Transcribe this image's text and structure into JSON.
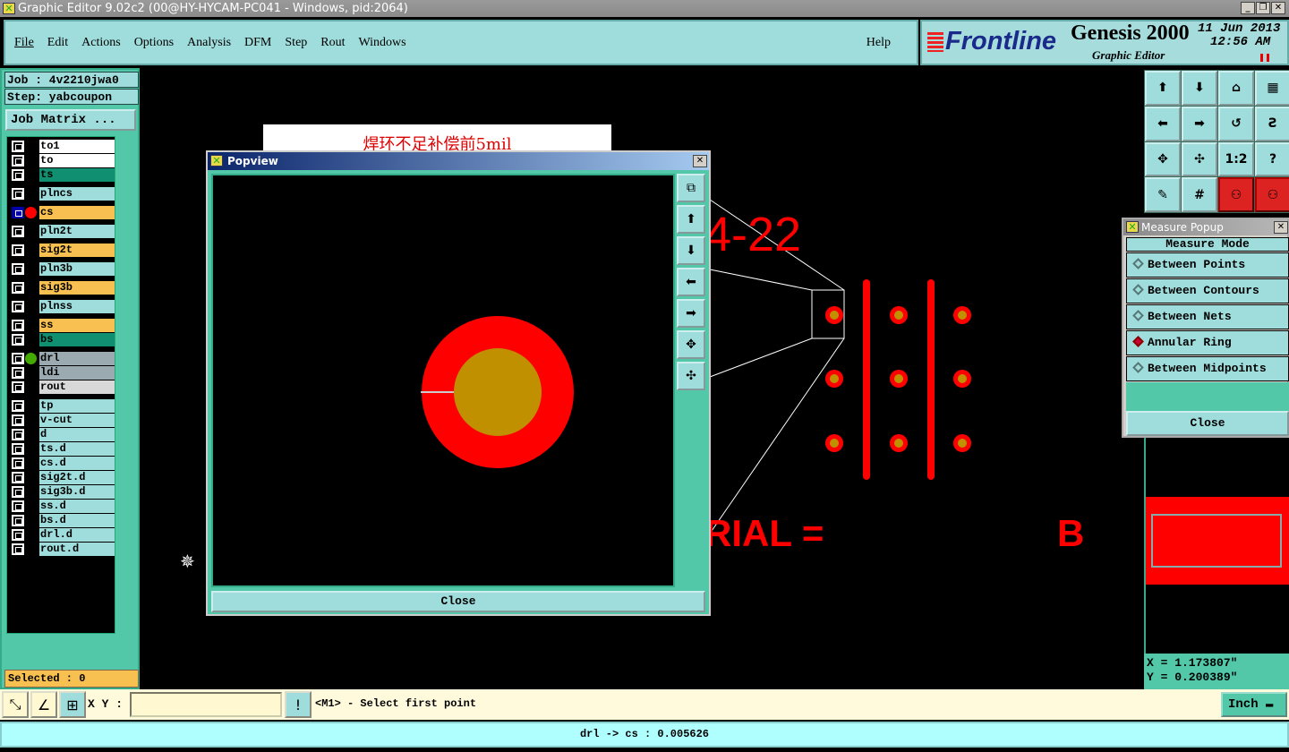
{
  "window": {
    "title": "Graphic Editor 9.02c2 (00@HY-HYCAM-PC041 - Windows, pid:2064)",
    "min": "_",
    "restore": "❐",
    "close": "✕"
  },
  "menu": {
    "items": [
      "File",
      "Edit",
      "Actions",
      "Options",
      "Analysis",
      "DFM",
      "Step",
      "Rout",
      "Windows"
    ],
    "help": "Help"
  },
  "brand": {
    "logo": "Frontline",
    "product": "Genesis 2000",
    "subtitle": "Graphic Editor",
    "date": "11 Jun 2013",
    "time": "12:56 AM"
  },
  "job": {
    "job": "Job : 4v2210jwa0",
    "step": "Step: yabcoupon",
    "matrix": "Job Matrix ..."
  },
  "layers": [
    {
      "name": "to1",
      "color": "#ffffff"
    },
    {
      "name": "to",
      "color": "#ffffff"
    },
    {
      "name": "ts",
      "color": "#109070"
    },
    {
      "name": "plncs",
      "color": "#9fdcdc"
    },
    {
      "name": "cs",
      "color": "#f7c050"
    },
    {
      "name": "pln2t",
      "color": "#9fdcdc"
    },
    {
      "name": "sig2t",
      "color": "#f7c050"
    },
    {
      "name": "pln3b",
      "color": "#9fdcdc"
    },
    {
      "name": "sig3b",
      "color": "#f7c050"
    },
    {
      "name": "plnss",
      "color": "#9fdcdc"
    },
    {
      "name": "ss",
      "color": "#f7c050"
    },
    {
      "name": "bs",
      "color": "#109070"
    },
    {
      "name": "drl",
      "color": "#9aaab0"
    },
    {
      "name": "ldi",
      "color": "#9aaab0"
    },
    {
      "name": "rout",
      "color": "#d8d8d8"
    },
    {
      "name": "tp",
      "color": "#9fdcdc"
    },
    {
      "name": "v-cut",
      "color": "#9fdcdc"
    },
    {
      "name": "d",
      "color": "#9fdcdc"
    },
    {
      "name": "ts.d",
      "color": "#9fdcdc"
    },
    {
      "name": "cs.d",
      "color": "#9fdcdc"
    },
    {
      "name": "sig2t.d",
      "color": "#9fdcdc"
    },
    {
      "name": "sig3b.d",
      "color": "#9fdcdc"
    },
    {
      "name": "ss.d",
      "color": "#9fdcdc"
    },
    {
      "name": "bs.d",
      "color": "#9fdcdc"
    },
    {
      "name": "drl.d",
      "color": "#9fdcdc"
    },
    {
      "name": "rout.d",
      "color": "#9fdcdc"
    }
  ],
  "selected": "Selected : 0",
  "measure": {
    "title": "Measure Popup",
    "header": "Measure Mode",
    "modes": [
      "Between Points",
      "Between Contours",
      "Between Nets",
      "Annular Ring",
      "Between Midpoints"
    ],
    "active": "Annular Ring",
    "close": "Close"
  },
  "coords": {
    "x": "X = 1.173807\"",
    "y": "Y = 0.200389\""
  },
  "popview": {
    "title": "Popview",
    "close": "Close"
  },
  "note": "焊环不足补偿前5mil",
  "canvas": {
    "text1": "4-22",
    "text2": "RIAL =",
    "text3": "B"
  },
  "bottom": {
    "xy_label": "X Y :",
    "xy_value": "",
    "prompt": "<M1> - Select first point",
    "units": "Inch"
  },
  "status": "drl -> cs : 0.005626",
  "colors": {
    "copper": "#ff0000",
    "drill": "#c09000",
    "panel": "#9fdcdc"
  }
}
